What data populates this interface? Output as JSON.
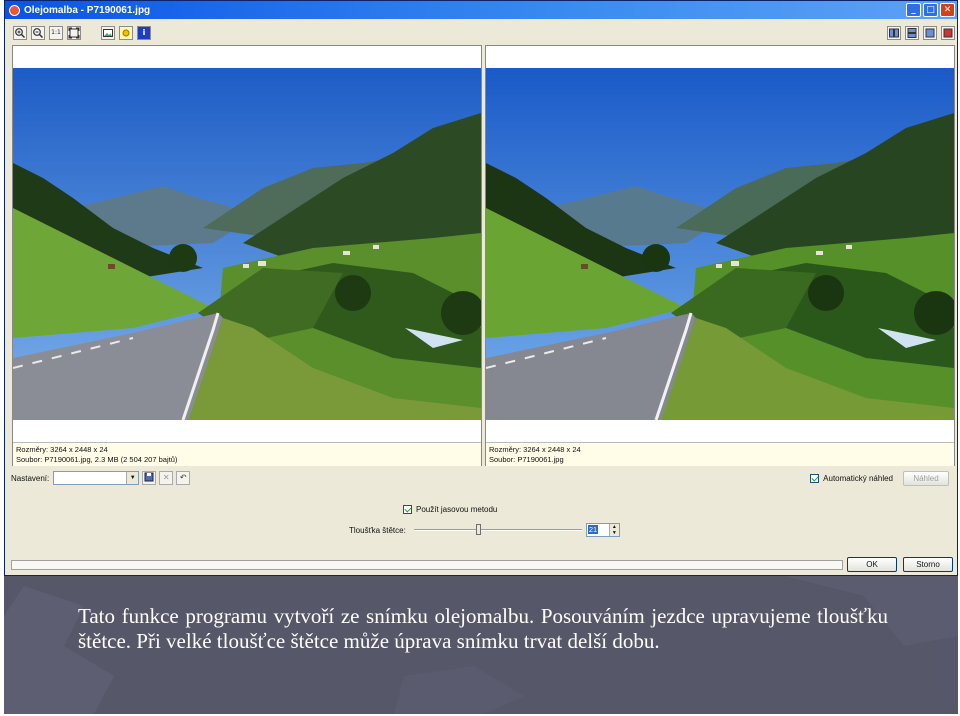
{
  "window": {
    "title": "Olejomalba - P7190061.jpg",
    "minimize_label": "_",
    "maximize_label": "□",
    "close_label": "✕"
  },
  "toolbar": {
    "left_icons": [
      "zoom-in-icon",
      "zoom-out-icon",
      "actual-size-icon",
      "fit-window-icon",
      "image-icon",
      "highlight-icon",
      "info-icon"
    ],
    "actual_size_label": "1:1",
    "info_label": "i",
    "right_icons": [
      "split-vertical-icon",
      "split-horizontal-icon",
      "single-view-icon",
      "preview-only-icon"
    ]
  },
  "left_panel": {
    "dimensions_label": "Rozměry: 3264 x 2448 x 24",
    "file_label": "Soubor: P7190061.jpg, 2.3 MB (2 504 207 bajtů)"
  },
  "right_panel": {
    "dimensions_label": "Rozměry: 3264 x 2448 x 24",
    "file_label": "Soubor: P7190061.jpg"
  },
  "settings": {
    "label": "Nastavení:",
    "value": ""
  },
  "auto_preview": {
    "label": "Automatický náhled",
    "checked": true,
    "preview_button": "Náhled"
  },
  "method": {
    "label": "Použít jasovou metodu",
    "checked": true
  },
  "brush": {
    "label": "Tloušťka štětce:",
    "value": "21",
    "slider_fraction": 0.38
  },
  "buttons": {
    "ok": "OK",
    "cancel": "Storno"
  },
  "caption": {
    "text": "Tato funkce programu vytvoří ze snímku olejomalbu. Posouváním jezdce upravujeme tloušťku štětce. Při velké tloušťce štětce může úprava snímku trvat delší dobu."
  },
  "colors": {
    "title_bar": "#0a54e6",
    "window_bg": "#ece9d8",
    "caption_bg": "#57576a"
  }
}
